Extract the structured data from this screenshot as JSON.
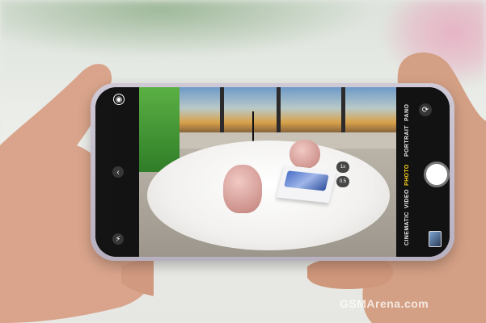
{
  "camera_ui": {
    "modes": [
      "CINEMATIC",
      "VIDEO",
      "PHOTO",
      "PORTRAIT",
      "PANO"
    ],
    "active_mode": "PHOTO",
    "zoom_options": [
      "1x",
      "0.5"
    ],
    "active_zoom": "1x",
    "icons": [
      "settings-icon",
      "flash-icon",
      "chevron-icon",
      "flip-camera-icon"
    ]
  },
  "watermark": "GSMArena.com",
  "colors": {
    "active_mode": "#ffd21f",
    "phone_frame": "#c9c2d1",
    "speaker": "#d09690"
  }
}
